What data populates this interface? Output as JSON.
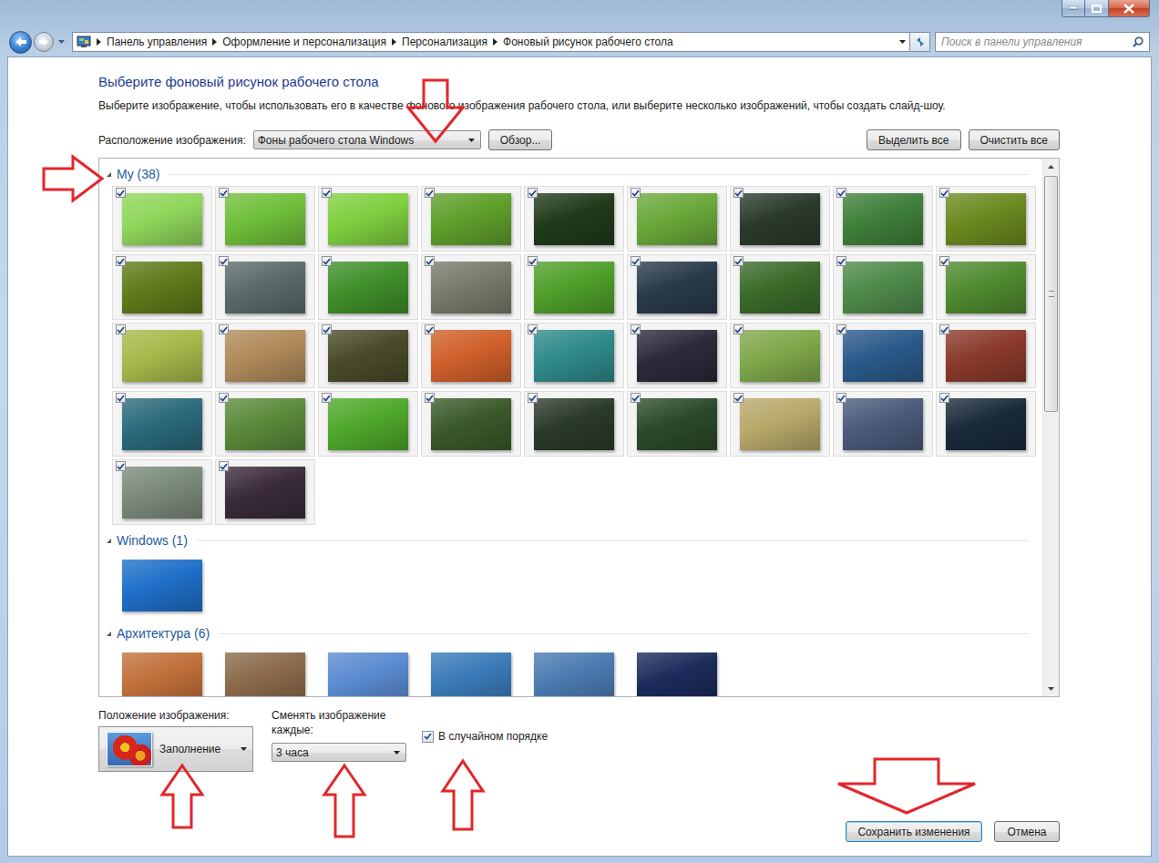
{
  "address_bar": {
    "breadcrumbs": [
      "Панель управления",
      "Оформление и персонализация",
      "Персонализация",
      "Фоновый рисунок рабочего стола"
    ]
  },
  "search": {
    "placeholder": "Поиск в панели управления"
  },
  "heading": "Выберите фоновый рисунок рабочего стола",
  "description": "Выберите изображение, чтобы использовать его в качестве фонового изображения рабочего стола, или выберите несколько изображений, чтобы создать слайд-шоу.",
  "location": {
    "label": "Расположение изображения:",
    "value": "Фоны рабочего стола Windows"
  },
  "browse_button": "Обзор...",
  "select_all_button": "Выделить все",
  "clear_all_button": "Очистить все",
  "gallery": {
    "scroll_thumb_share": 0.47,
    "groups": [
      {
        "title": "My (38)",
        "expanded": true,
        "images": [
          {
            "color": "#8fd65a",
            "checked": true
          },
          {
            "color": "#6fbf3a",
            "checked": true
          },
          {
            "color": "#7fcf3f",
            "checked": true
          },
          {
            "color": "#5f9f2a",
            "checked": true
          },
          {
            "color": "#1f3a1a",
            "checked": true
          },
          {
            "color": "#6aa83a",
            "checked": true
          },
          {
            "color": "#2a3a2a",
            "checked": true
          },
          {
            "color": "#3f7f3a",
            "checked": true
          },
          {
            "color": "#6a8a1f",
            "checked": true
          },
          {
            "color": "#5f7a1a",
            "checked": true
          },
          {
            "color": "#5a6a6a",
            "checked": true
          },
          {
            "color": "#3f8f2a",
            "checked": true
          },
          {
            "color": "#7a7a6a",
            "checked": true
          },
          {
            "color": "#4f9f2a",
            "checked": true
          },
          {
            "color": "#2a3a4a",
            "checked": true
          },
          {
            "color": "#3a6a2a",
            "checked": true
          },
          {
            "color": "#4f8a4a",
            "checked": true
          },
          {
            "color": "#4f8a2f",
            "checked": true
          },
          {
            "color": "#a8b84a",
            "checked": true
          },
          {
            "color": "#b08a5a",
            "checked": true
          },
          {
            "color": "#4a4a2a",
            "checked": true
          },
          {
            "color": "#d0602a",
            "checked": true
          },
          {
            "color": "#2f8a8a",
            "checked": true
          },
          {
            "color": "#2a2a3a",
            "checked": true
          },
          {
            "color": "#7fa84a",
            "checked": true
          },
          {
            "color": "#2a5a8a",
            "checked": true
          },
          {
            "color": "#8a3a2a",
            "checked": true
          },
          {
            "color": "#2a6a7a",
            "checked": true
          },
          {
            "color": "#5a8a3a",
            "checked": true
          },
          {
            "color": "#4fa82a",
            "checked": true
          },
          {
            "color": "#3a5a2a",
            "checked": true
          },
          {
            "color": "#2a3a2a",
            "checked": true
          },
          {
            "color": "#2a4a2a",
            "checked": true
          },
          {
            "color": "#b8a86a",
            "checked": true
          },
          {
            "color": "#4a5a7a",
            "checked": true
          },
          {
            "color": "#1a2a3a",
            "checked": true
          },
          {
            "color": "#7a8a7a",
            "checked": true
          },
          {
            "color": "#3a2a3a",
            "checked": true
          }
        ]
      },
      {
        "title": "Windows (1)",
        "expanded": true,
        "images": [
          {
            "color": "#1f6fc8",
            "checked": false
          }
        ]
      },
      {
        "title": "Архитектура (6)",
        "expanded": true,
        "images": [
          {
            "color": "#c0703a",
            "checked": false
          },
          {
            "color": "#8a6a4a",
            "checked": false
          },
          {
            "color": "#5a8ad0",
            "checked": false
          },
          {
            "color": "#3a7ab8",
            "checked": false
          },
          {
            "color": "#4a7ab0",
            "checked": false
          },
          {
            "color": "#1a2a5a",
            "checked": false
          }
        ]
      }
    ]
  },
  "position": {
    "label": "Положение изображения:",
    "value": "Заполнение"
  },
  "interval": {
    "label": "Сменять изображение каждые:",
    "value": "3 часа"
  },
  "shuffle": {
    "label": "В случайном порядке",
    "checked": true
  },
  "buttons": [
    {
      "label": "Сохранить изменения",
      "default": true
    },
    {
      "label": "Отмена",
      "default": false
    }
  ]
}
